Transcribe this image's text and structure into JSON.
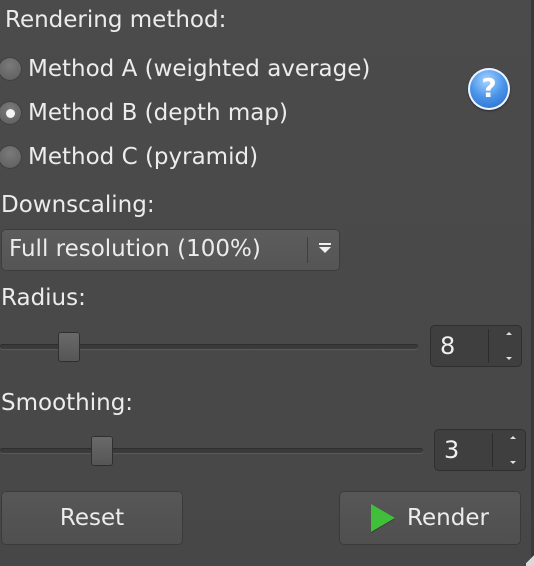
{
  "rendering": {
    "label": "Rendering method:",
    "options": [
      {
        "label": "Method A (weighted average)",
        "selected": false
      },
      {
        "label": "Method B (depth map)",
        "selected": true
      },
      {
        "label": "Method C (pyramid)",
        "selected": false
      }
    ],
    "help_icon": "question-mark-icon",
    "help_glyph": "?"
  },
  "downscaling": {
    "label": "Downscaling:",
    "selected": "Full resolution (100%)"
  },
  "radius": {
    "label": "Radius:",
    "value": "8"
  },
  "smoothing": {
    "label": "Smoothing:",
    "value": "3"
  },
  "buttons": {
    "reset": "Reset",
    "render": "Render",
    "render_icon": "play-icon"
  },
  "colors": {
    "background": "#4a4a4a",
    "text": "#ececec",
    "help_blue": "#4a95ea",
    "play_green": "#3fbf3a"
  }
}
